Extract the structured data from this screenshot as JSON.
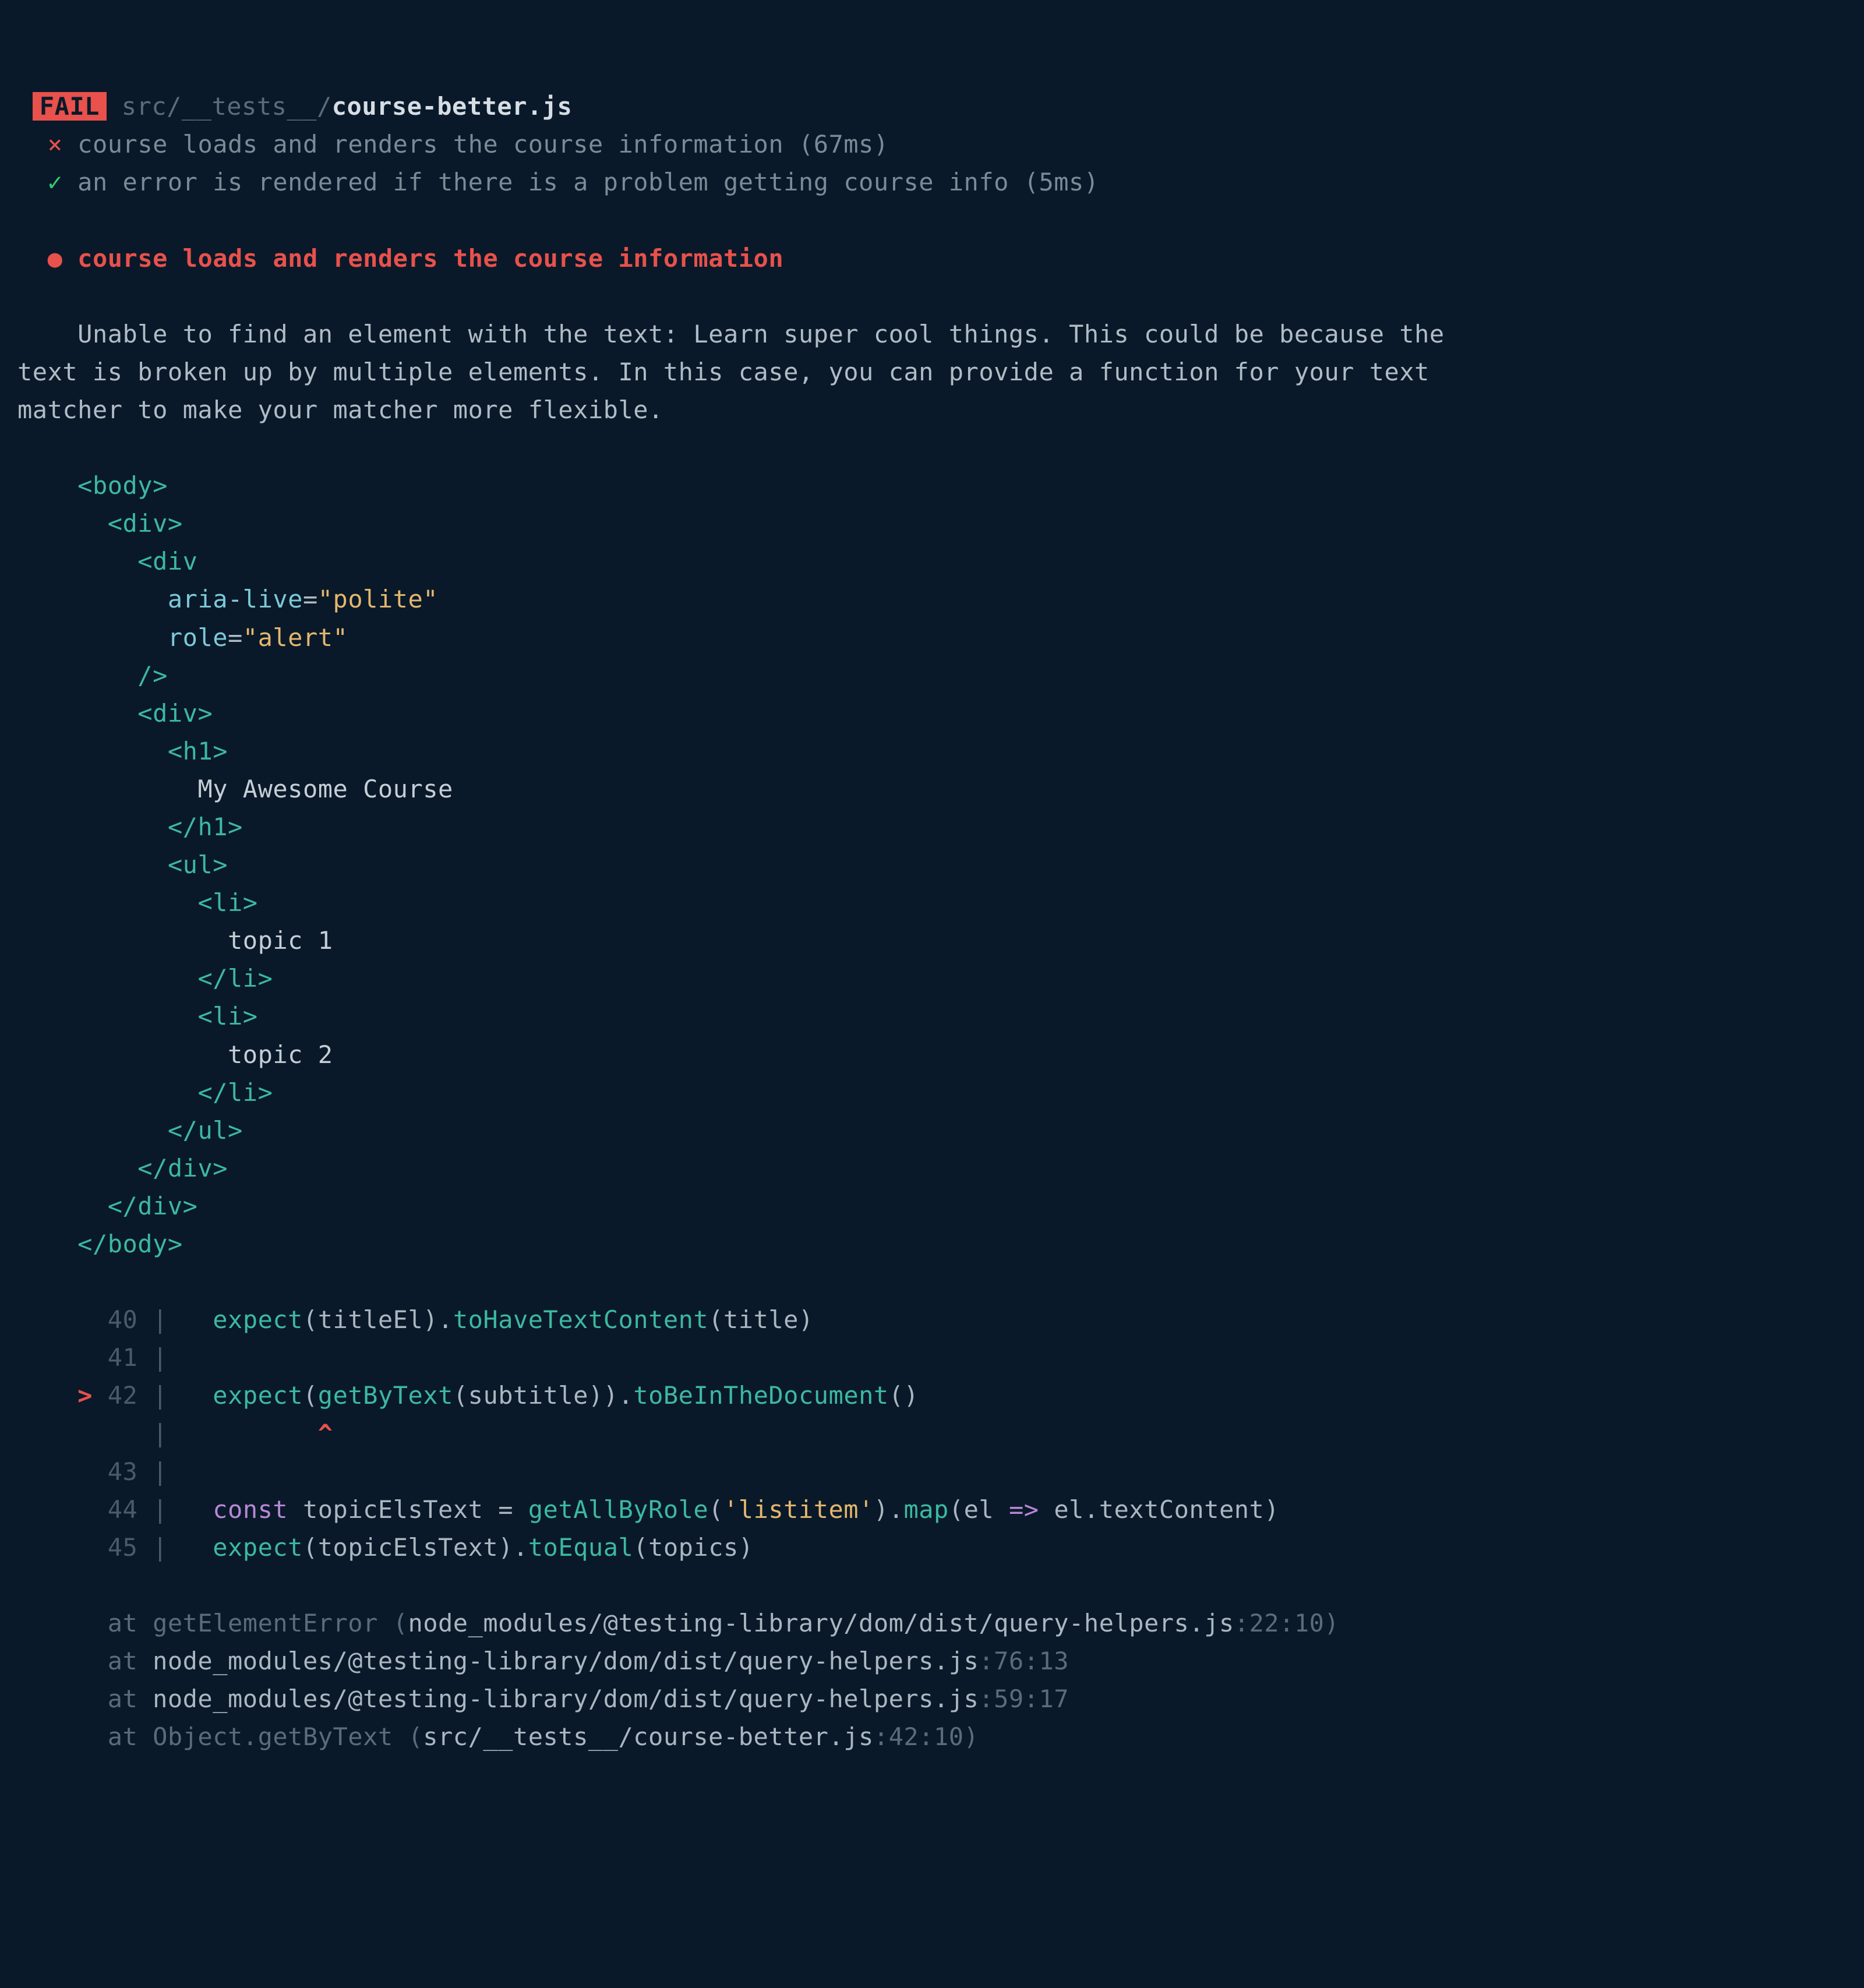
{
  "header": {
    "badge": "FAIL",
    "pathDim": "src/__tests__/",
    "pathBright": "course-better.js"
  },
  "tests": {
    "failMark": "×",
    "failName": "course loads and renders the course information (67ms)",
    "passMark": "✓",
    "passName": "an error is rendered if there is a problem getting course info (5ms)"
  },
  "failure": {
    "bullet": "●",
    "title": "course loads and renders the course information",
    "message": "Unable to find an element with the text: Learn super cool things. This could be because the\ntext is broken up by multiple elements. In this case, you can provide a function for your text\nmatcher to make your matcher more flexible."
  },
  "dom": {
    "bodyOpen": "<body>",
    "divOpen1": "<div>",
    "divOpen2": "<div",
    "ariaAttr": "aria-live",
    "ariaVal": "\"polite\"",
    "roleAttr": "role",
    "roleVal": "\"alert\"",
    "selfClose": "/>",
    "divOpen3": "<div>",
    "h1Open": "<h1>",
    "h1Text": "My Awesome Course",
    "h1Close": "</h1>",
    "ulOpen": "<ul>",
    "liOpen": "<li>",
    "topic1": "topic 1",
    "liClose": "</li>",
    "topic2": "topic 2",
    "ulClose": "</ul>",
    "divClose": "</div>",
    "bodyClose": "</body>"
  },
  "code": {
    "ln40": "40",
    "ln41": "41",
    "ln42": "42",
    "ln43": "43",
    "ln44": "44",
    "ln45": "45",
    "pipe": "|",
    "ptr": ">",
    "caret": "^",
    "l40a": "expect",
    "l40b": "(titleEl).",
    "l40c": "toHaveTextContent",
    "l40d": "(title)",
    "l42a": "expect",
    "l42b": "(",
    "l42c": "getByText",
    "l42d": "(subtitle)).",
    "l42e": "toBeInTheDocument",
    "l42f": "()",
    "l44const": "const",
    "l44a": " topicElsText = ",
    "l44b": "getAllByRole",
    "l44c": "(",
    "l44str": "'listitem'",
    "l44d": ").",
    "l44e": "map",
    "l44f": "(el ",
    "l44arrow": "=>",
    "l44g": " el.textContent)",
    "l45a": "expect",
    "l45b": "(topicElsText).",
    "l45c": "toEqual",
    "l45d": "(topics)"
  },
  "stack": {
    "s1a": "at getElementError (",
    "s1b": "node_modules/@testing-library/dom/dist/query-helpers.js",
    "s1c": ":22:10)",
    "s2a": "at ",
    "s2b": "node_modules/@testing-library/dom/dist/query-helpers.js",
    "s2c": ":76:13",
    "s3a": "at ",
    "s3b": "node_modules/@testing-library/dom/dist/query-helpers.js",
    "s3c": ":59:17",
    "s4a": "at Object.getByText (",
    "s4b": "src/__tests__/course-better.js",
    "s4c": ":42:10)"
  }
}
